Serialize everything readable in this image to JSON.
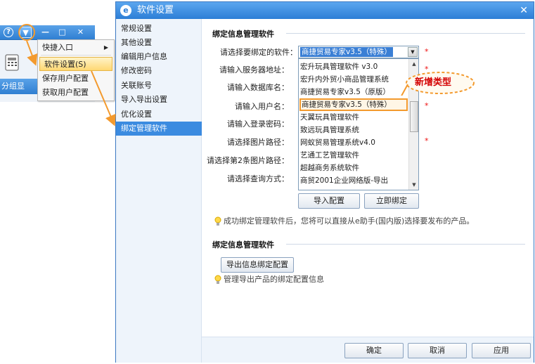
{
  "mini_window": {
    "help_icon": "?",
    "menu_icon": "▼",
    "min_icon": "—",
    "max_icon": "□",
    "close_icon": "✕",
    "bottom_text": "分组显"
  },
  "dropdown_menu": {
    "items": [
      {
        "label": "快捷入口",
        "submenu": true
      },
      {
        "label": "软件设置(S)",
        "selected": true
      },
      {
        "label": "保存用户配置"
      },
      {
        "label": "获取用户配置"
      }
    ]
  },
  "dialog": {
    "title": "软件设置",
    "close": "✕",
    "nav": [
      {
        "label": "常规设置"
      },
      {
        "label": "其他设置"
      },
      {
        "label": "编辑用户信息"
      },
      {
        "label": "修改密码"
      },
      {
        "label": "关联账号"
      },
      {
        "label": "导入导出设置"
      },
      {
        "label": "优化设置"
      },
      {
        "label": "绑定管理软件",
        "active": true
      }
    ],
    "section1": {
      "title": "绑定信息管理软件",
      "labels": {
        "software": "请选择要绑定的软件：",
        "server": "请输入服务器地址：",
        "database": "请输入数据库名：",
        "username": "请输入用户名：",
        "password": "请输入登录密码：",
        "image_path": "请选择图片路径：",
        "image_path2": "请选择第2条图片路径：",
        "query": "请选择查询方式："
      },
      "required_mark": "*",
      "selected_value": "商捷贸易专家v3.5（特殊）",
      "options": [
        "宏升玩具管理软件 v3.0",
        "宏升内外贸小商品管理系统",
        "商捷贸易专家v3.5（原版）",
        "商捷贸易专家v3.5（特殊）",
        "天翼玩具管理软件",
        "致远玩具管理系统",
        "网蚁贸易管理系统v4.0",
        "艺通工艺管理软件",
        "超越商务系统软件",
        "商贸2001企业网络版-导出"
      ],
      "highlighted_index": 3,
      "import_button": "导入配置",
      "bind_button": "立即绑定",
      "tip": "成功绑定管理软件后，您将可以直接从e助手(国内版)选择要发布的产品。"
    },
    "section2": {
      "title": "绑定信息管理软件",
      "export_button": "导出信息绑定配置",
      "tip": "管理导出产品的绑定配置信息"
    },
    "footer": {
      "ok": "确定",
      "cancel": "取消",
      "apply": "应用"
    }
  },
  "callout": {
    "text": "新增类型"
  },
  "colors": {
    "accent": "#2c7ed6",
    "annotation": "#f39a2e",
    "callout_text": "#d40000"
  }
}
